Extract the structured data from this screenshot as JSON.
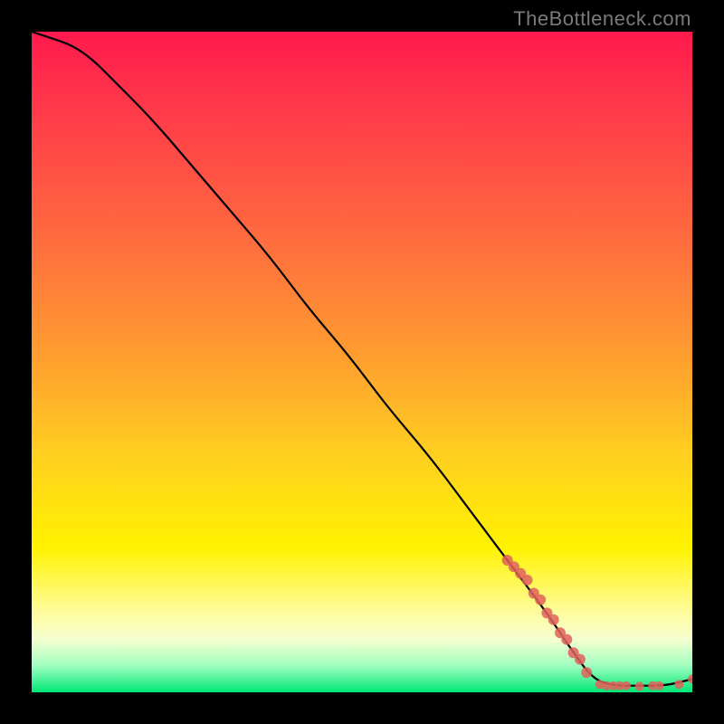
{
  "attribution": "TheBottleneck.com",
  "chart_data": {
    "type": "line",
    "title": "",
    "xlabel": "",
    "ylabel": "",
    "xlim": [
      0,
      100
    ],
    "ylim": [
      0,
      100
    ],
    "grid": false,
    "legend": false,
    "series": [
      {
        "name": "curve",
        "x": [
          0,
          3,
          6,
          9,
          12,
          18,
          24,
          30,
          36,
          42,
          48,
          54,
          60,
          66,
          72,
          78,
          82,
          85,
          88,
          92,
          96,
          100
        ],
        "y": [
          100,
          99,
          98,
          96,
          93,
          87,
          80,
          73,
          66,
          58,
          51,
          43,
          36,
          28,
          20,
          12,
          6,
          2,
          1,
          1,
          1,
          2
        ]
      }
    ],
    "scatter_bands": [
      {
        "name": "descent-clump",
        "points": [
          {
            "x": 72,
            "y": 20
          },
          {
            "x": 73,
            "y": 19
          },
          {
            "x": 74,
            "y": 18
          },
          {
            "x": 75,
            "y": 17
          },
          {
            "x": 76,
            "y": 15
          },
          {
            "x": 77,
            "y": 14
          },
          {
            "x": 78,
            "y": 12
          },
          {
            "x": 79,
            "y": 11
          },
          {
            "x": 80,
            "y": 9
          },
          {
            "x": 81,
            "y": 8
          },
          {
            "x": 82,
            "y": 6
          },
          {
            "x": 83,
            "y": 5
          },
          {
            "x": 84,
            "y": 3
          }
        ]
      },
      {
        "name": "floor-clump",
        "points": [
          {
            "x": 86,
            "y": 1.2
          },
          {
            "x": 87,
            "y": 1.0
          },
          {
            "x": 88,
            "y": 1.0
          },
          {
            "x": 89,
            "y": 1.0
          },
          {
            "x": 90,
            "y": 1.0
          },
          {
            "x": 92,
            "y": 0.9
          },
          {
            "x": 94,
            "y": 1.0
          },
          {
            "x": 95,
            "y": 1.0
          },
          {
            "x": 98,
            "y": 1.2
          },
          {
            "x": 100,
            "y": 2.0
          }
        ]
      }
    ],
    "colors": {
      "curve": "#000000",
      "scatter": "#e1625a"
    }
  }
}
